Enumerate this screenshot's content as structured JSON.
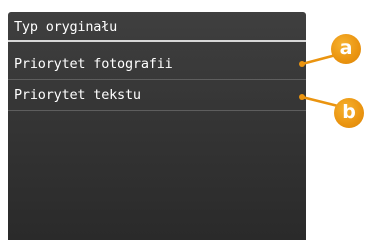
{
  "screen": {
    "title": "Typ oryginału",
    "items": [
      {
        "label": "Priorytet fotografii"
      },
      {
        "label": "Priorytet tekstu"
      }
    ]
  },
  "callouts": [
    {
      "letter": "a"
    },
    {
      "letter": "b"
    }
  ],
  "colors": {
    "screen_bg": "#3a3a3a",
    "text": "#ffffff",
    "accent": "#ea9410"
  }
}
